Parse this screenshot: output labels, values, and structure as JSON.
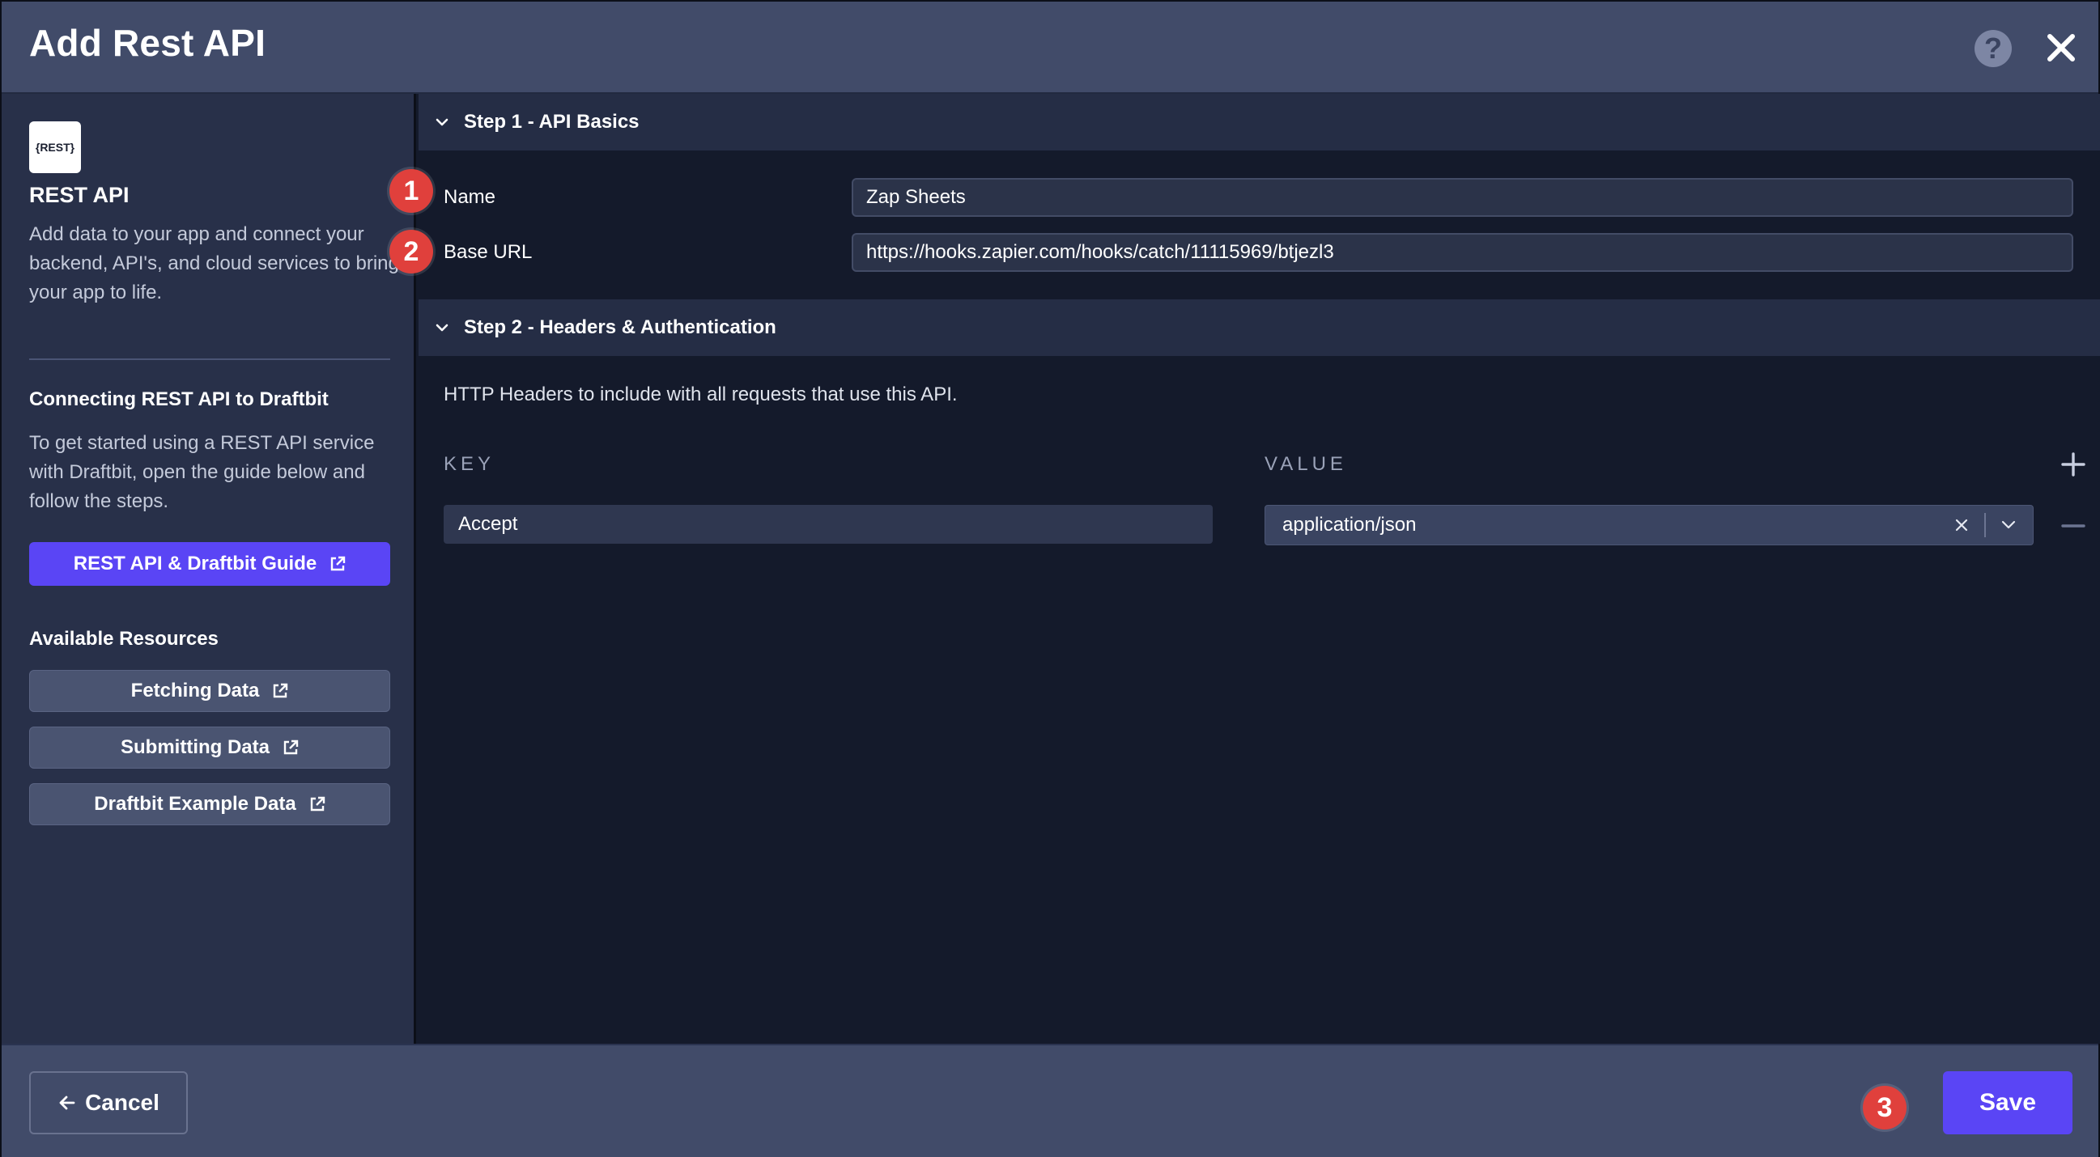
{
  "dialog": {
    "title": "Add Rest API",
    "help_label": "?"
  },
  "sidebar": {
    "logo_text": "{REST}",
    "title": "REST API",
    "description": "Add data to your app and connect your backend, API's, and cloud services to bring your app to life.",
    "connect_heading": "Connecting REST API to Draftbit",
    "connect_description": "To get started using a REST API service with Draftbit, open the guide below and follow the steps.",
    "guide_button": "REST API & Draftbit Guide",
    "resources_heading": "Available Resources",
    "resources": [
      {
        "label": "Fetching Data"
      },
      {
        "label": "Submitting Data"
      },
      {
        "label": "Draftbit Example Data"
      }
    ]
  },
  "step1": {
    "title": "Step 1 - API Basics",
    "name_label": "Name",
    "name_value": "Zap Sheets",
    "base_url_label": "Base URL",
    "base_url_value": "https://hooks.zapier.com/hooks/catch/11115969/btjezl3"
  },
  "step2": {
    "title": "Step 2 - Headers & Authentication",
    "hint": "HTTP Headers to include with all requests that use this API.",
    "key_header": "KEY",
    "value_header": "VALUE",
    "headers": [
      {
        "key": "Accept",
        "value": "application/json"
      }
    ]
  },
  "annotations": {
    "badge_1": "1",
    "badge_2": "2",
    "badge_3": "3"
  },
  "footer": {
    "cancel_label": "Cancel",
    "save_label": "Save"
  },
  "colors": {
    "accent": "#5a45f5",
    "badge": "#e0403c",
    "header_bg": "#414b69",
    "panel_bg": "#141a2b"
  }
}
